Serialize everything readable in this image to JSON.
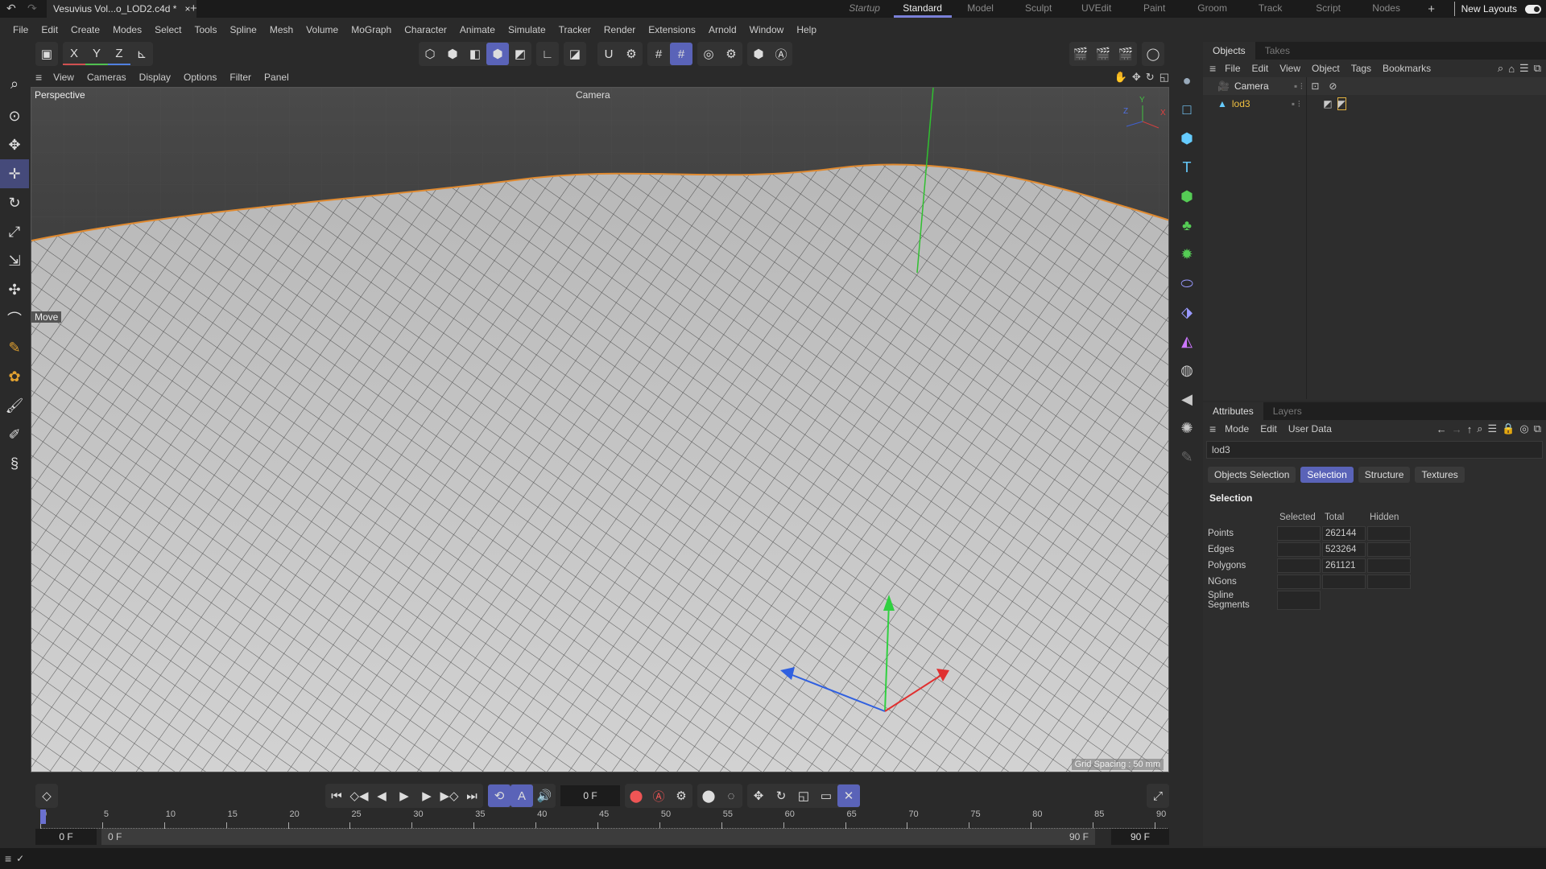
{
  "titlebar": {
    "file_tab": "Vesuvius Vol...o_LOD2.c4d *",
    "close": "×",
    "add": "+",
    "layouts": [
      "Startup",
      "Standard",
      "Model",
      "Sculpt",
      "UVEdit",
      "Paint",
      "Groom",
      "Track",
      "Script",
      "Nodes"
    ],
    "active_layout": "Standard",
    "add_layout": "+",
    "new_layouts": "New Layouts"
  },
  "menubar": [
    "File",
    "Edit",
    "Create",
    "Modes",
    "Select",
    "Tools",
    "Spline",
    "Mesh",
    "Volume",
    "MoGraph",
    "Character",
    "Animate",
    "Simulate",
    "Tracker",
    "Render",
    "Extensions",
    "Arnold",
    "Window",
    "Help"
  ],
  "toolbar": {
    "x": "X",
    "y": "Y",
    "z": "Z"
  },
  "viewport": {
    "menu": [
      "View",
      "Cameras",
      "Display",
      "Options",
      "Filter",
      "Panel"
    ],
    "name": "Perspective",
    "camera": "Camera",
    "tool_label": "Move",
    "grid_spacing": "Grid Spacing : 50 mm",
    "axis_y": "Y",
    "axis_z": "Z",
    "axis_x": "X"
  },
  "objects": {
    "tabs": [
      "Objects",
      "Takes"
    ],
    "menu": [
      "File",
      "Edit",
      "View",
      "Object",
      "Tags",
      "Bookmarks"
    ],
    "items": [
      {
        "name": "Camera",
        "color": "#dddddd"
      },
      {
        "name": "lod3",
        "color": "#f0c040"
      }
    ]
  },
  "attributes": {
    "tabs": [
      "Attributes",
      "Layers"
    ],
    "menu": [
      "Mode",
      "Edit",
      "User Data"
    ],
    "object_name": "lod3",
    "subtabs": [
      "Objects Selection",
      "Selection",
      "Structure",
      "Textures"
    ],
    "active_subtab": "Selection",
    "section": "Selection",
    "columns": [
      "Selected",
      "Total",
      "Hidden"
    ],
    "rows": [
      {
        "label": "Points",
        "selected": "",
        "total": "262144",
        "hidden": ""
      },
      {
        "label": "Edges",
        "selected": "",
        "total": "523264",
        "hidden": ""
      },
      {
        "label": "Polygons",
        "selected": "",
        "total": "261121",
        "hidden": ""
      },
      {
        "label": "NGons",
        "selected": "",
        "total": "",
        "hidden": ""
      },
      {
        "label": "Spline Segments",
        "selected": ""
      }
    ]
  },
  "timeline": {
    "current_frame": "0 F",
    "ticks": [
      "0",
      "5",
      "10",
      "15",
      "20",
      "25",
      "30",
      "35",
      "40",
      "45",
      "50",
      "55",
      "60",
      "65",
      "70",
      "75",
      "80",
      "85",
      "90"
    ],
    "start": "0 F",
    "range_start": "0 F",
    "range_end": "90 F",
    "end": "90 F"
  }
}
